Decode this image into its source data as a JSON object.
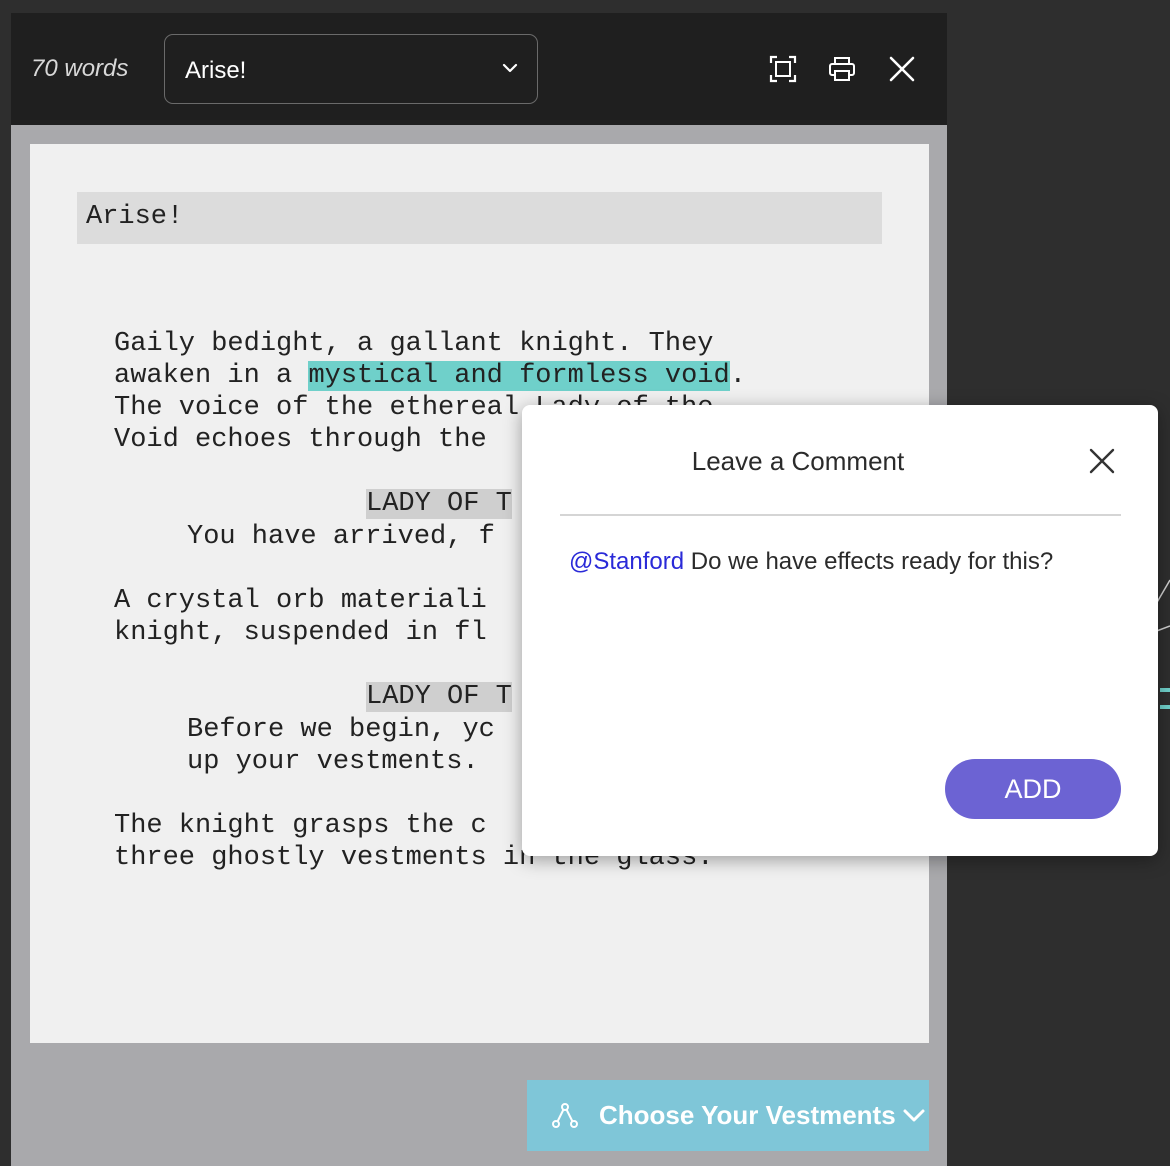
{
  "toolbar": {
    "word_count": "70 words",
    "scene_select_value": "Arise!",
    "icons": [
      "focus-mode-icon",
      "print-icon",
      "close-icon"
    ]
  },
  "script": {
    "heading": "Arise!",
    "p1_l1": "Gaily bedight, a gallant knight. They",
    "p1_l2_pre": "awaken in a ",
    "p1_l2_hl": "mystical and formless void",
    "p1_l2_post": ".",
    "p1_l3": "The voice of the ethereal Lady of the",
    "p1_l4": "Void echoes through the",
    "char1": "LADY OF T",
    "d1": "You have arrived, f",
    "p2_l1": "A crystal orb materiali",
    "p2_l2": "knight, suspended in fl",
    "char2": "LADY OF T",
    "d2_l1": "Before we begin, yc",
    "d2_l2": "up your vestments.",
    "p3_l1": "The knight grasps the c",
    "p3_l2": "three ghostly vestments in the glass."
  },
  "choice": {
    "label": "Choose Your Vestments",
    "color": "#7fc6d8"
  },
  "comment_modal": {
    "title": "Leave a Comment",
    "mention": "@Stanford",
    "text": " Do we have effects ready for this?",
    "add_label": "ADD",
    "add_color": "#6c63d3"
  },
  "colors": {
    "highlight": "#6fd0ca",
    "toolbar_bg": "#1f1f1f",
    "page_bg": "#f0f0f0"
  }
}
